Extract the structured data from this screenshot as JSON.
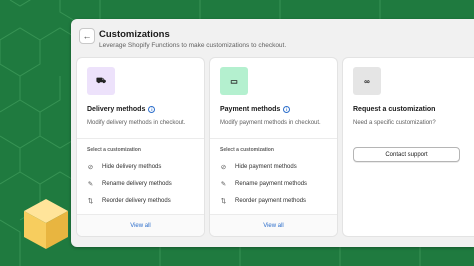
{
  "colors": {
    "background": "#1f7a3f",
    "accent_link": "#2c6ecb",
    "cube_light": "#ffe49a",
    "cube_mid": "#f7cd5e",
    "cube_dark": "#e8b540"
  },
  "header": {
    "back_icon": "←",
    "title": "Customizations",
    "subtitle": "Leverage Shopify Functions to make customizations to checkout."
  },
  "cards": [
    {
      "icon_name": "truck-icon",
      "icon_glyph": "⛟",
      "heading": "Delivery methods",
      "info_glyph": "i",
      "description": "Modify delivery methods in checkout.",
      "select_label": "Select a customization",
      "options": [
        {
          "icon": "hide-icon",
          "glyph": "⊘",
          "label": "Hide delivery methods"
        },
        {
          "icon": "edit-icon",
          "glyph": "✎",
          "label": "Rename delivery methods"
        },
        {
          "icon": "reorder-icon",
          "glyph": "⇅",
          "label": "Reorder delivery methods"
        }
      ],
      "footer_link": "View all"
    },
    {
      "icon_name": "payment-icon",
      "icon_glyph": "▭",
      "heading": "Payment methods",
      "info_glyph": "i",
      "description": "Modify payment methods in checkout.",
      "select_label": "Select a customization",
      "options": [
        {
          "icon": "hide-icon",
          "glyph": "⊘",
          "label": "Hide payment methods"
        },
        {
          "icon": "edit-icon",
          "glyph": "✎",
          "label": "Rename payment methods"
        },
        {
          "icon": "reorder-icon",
          "glyph": "⇅",
          "label": "Reorder payment methods"
        }
      ],
      "footer_link": "View all"
    },
    {
      "icon_name": "link-icon",
      "icon_glyph": "∞",
      "heading": "Request a customization",
      "description": "Need a specific customization?",
      "button_label": "Contact support"
    }
  ]
}
